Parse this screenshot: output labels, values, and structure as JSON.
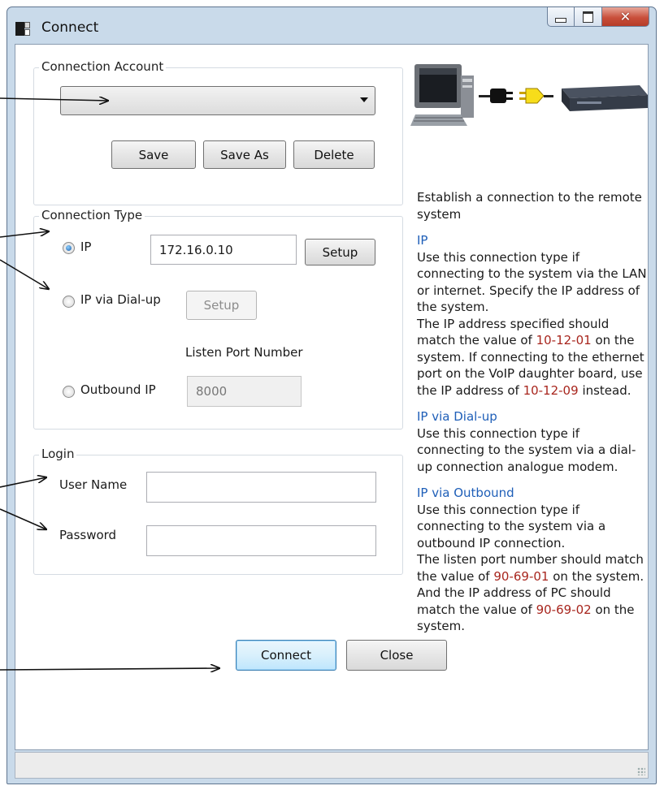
{
  "window": {
    "title": "Connect"
  },
  "account": {
    "group_label": "Connection Account",
    "selected": "",
    "save_label": "Save",
    "save_as_label": "Save As",
    "delete_label": "Delete"
  },
  "conn_type": {
    "group_label": "Connection Type",
    "ip_label": "IP",
    "ip_value": "172.16.0.10",
    "setup_label": "Setup",
    "dialup_label": "IP via Dial-up",
    "dialup_setup_label": "Setup",
    "listen_port_label": "Listen Port Number",
    "outbound_label": "Outbound IP",
    "port_value": "8000",
    "selected": "IP"
  },
  "login": {
    "group_label": "Login",
    "username_label": "User Name",
    "username_value": "",
    "password_label": "Password",
    "password_value": ""
  },
  "help": {
    "intro": "Establish a connection to the remote system",
    "ip_heading": "IP",
    "ip_text_1": "Use this connection type if connecting to the system via the LAN or internet. Specify the IP address of the system.",
    "ip_text_2a": "The IP address specified should match the value of",
    "ip_code_1": "10-12-01",
    "ip_text_2b": "on the system. If connecting to the ethernet port on the VoIP daughter board, use the IP address of",
    "ip_code_2": "10-12-09",
    "ip_text_2c": "instead.",
    "dialup_heading": "IP via Dial-up",
    "dialup_text": "Use this connection type if connecting to the system via a dial-up connection analogue modem.",
    "outbound_heading": "IP via Outbound",
    "outbound_text_1": "Use this connection type if connecting to the system via a outbound IP connection.",
    "outbound_text_2a": "The listen port number should match the value of",
    "outbound_code_1": "90-69-01",
    "outbound_text_2b": "on the system. And the IP address of PC should match the value of",
    "outbound_code_2": "90-69-02",
    "outbound_text_2c": "on the system."
  },
  "footer": {
    "connect_label": "Connect",
    "close_label": "Close"
  },
  "icons": {
    "illustration": "pc-plug-device-illustration"
  }
}
